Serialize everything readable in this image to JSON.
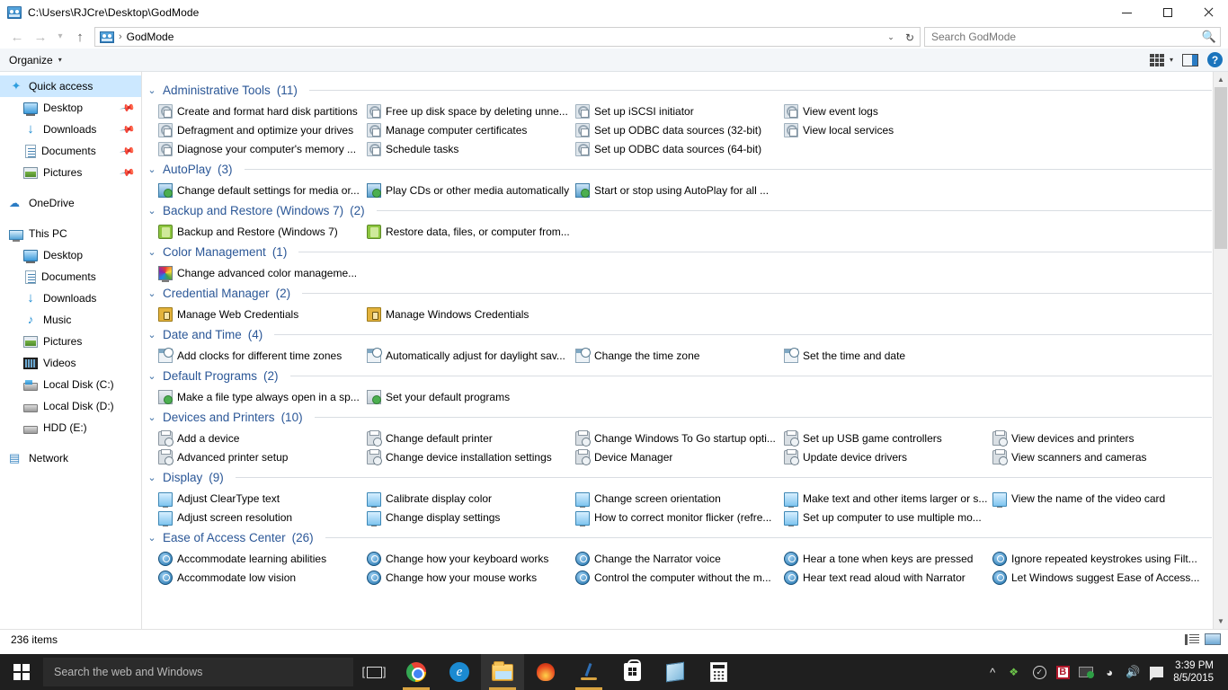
{
  "window": {
    "title": "C:\\Users\\RJCre\\Desktop\\GodMode",
    "minimize_label": "Minimize",
    "maximize_label": "Maximize",
    "close_label": "Close"
  },
  "address": {
    "back_label": "Back",
    "forward_label": "Forward",
    "recent_label": "Recent locations",
    "up_label": "Up",
    "crumb": "GodMode",
    "separator": "›",
    "dropdown": "⌄",
    "refresh": "↻"
  },
  "search": {
    "placeholder": "Search GodMode",
    "value": "",
    "icon": "search-icon"
  },
  "toolbar": {
    "organize_label": "Organize",
    "caret": "▾",
    "view_icon": "grid-view-icon",
    "preview_icon": "preview-pane-icon",
    "help_label": "?"
  },
  "sidebar": {
    "items": [
      {
        "label": "Quick access",
        "icon": "star-icon",
        "indent": 0,
        "selected": true,
        "pinned": false
      },
      {
        "label": "Desktop",
        "icon": "desktop-icon",
        "indent": 1,
        "selected": false,
        "pinned": true
      },
      {
        "label": "Downloads",
        "icon": "download-icon",
        "indent": 1,
        "selected": false,
        "pinned": true
      },
      {
        "label": "Documents",
        "icon": "document-icon",
        "indent": 1,
        "selected": false,
        "pinned": true
      },
      {
        "label": "Pictures",
        "icon": "picture-icon",
        "indent": 1,
        "selected": false,
        "pinned": true
      },
      {
        "label": "OneDrive",
        "icon": "cloud-icon",
        "indent": 0,
        "selected": false,
        "pinned": false,
        "gap_before": true
      },
      {
        "label": "This PC",
        "icon": "pc-icon",
        "indent": 0,
        "selected": false,
        "pinned": false,
        "gap_before": true
      },
      {
        "label": "Desktop",
        "icon": "desktop-icon",
        "indent": 1,
        "selected": false,
        "pinned": false
      },
      {
        "label": "Documents",
        "icon": "document-icon",
        "indent": 1,
        "selected": false,
        "pinned": false
      },
      {
        "label": "Downloads",
        "icon": "download-icon",
        "indent": 1,
        "selected": false,
        "pinned": false
      },
      {
        "label": "Music",
        "icon": "music-icon",
        "indent": 1,
        "selected": false,
        "pinned": false
      },
      {
        "label": "Pictures",
        "icon": "picture-icon",
        "indent": 1,
        "selected": false,
        "pinned": false
      },
      {
        "label": "Videos",
        "icon": "video-icon",
        "indent": 1,
        "selected": false,
        "pinned": false
      },
      {
        "label": "Local Disk (C:)",
        "icon": "system-drive-icon",
        "indent": 1,
        "selected": false,
        "pinned": false
      },
      {
        "label": "Local Disk (D:)",
        "icon": "drive-icon",
        "indent": 1,
        "selected": false,
        "pinned": false
      },
      {
        "label": "HDD (E:)",
        "icon": "drive-icon",
        "indent": 1,
        "selected": false,
        "pinned": false
      },
      {
        "label": "Network",
        "icon": "network-icon",
        "indent": 0,
        "selected": false,
        "pinned": false,
        "gap_before": true
      }
    ]
  },
  "groups": [
    {
      "title": "Administrative Tools",
      "count": "(11)",
      "icon_class": "i-admin",
      "icon_name": "administrative-tools-icon",
      "items": [
        "Create and format hard disk partitions",
        "Defragment and optimize your drives",
        "Diagnose your computer's memory ...",
        "Free up disk space by deleting unne...",
        "Manage computer certificates",
        "Schedule tasks",
        "Set up iSCSI initiator",
        "Set up ODBC data sources (32-bit)",
        "Set up ODBC data sources (64-bit)",
        "View event logs",
        "View local services"
      ]
    },
    {
      "title": "AutoPlay",
      "count": "(3)",
      "icon_class": "i-autoplay",
      "icon_name": "autoplay-icon",
      "items": [
        "Change default settings for media or...",
        "Play CDs or other media automatically",
        "Start or stop using AutoPlay for all ..."
      ]
    },
    {
      "title": "Backup and Restore (Windows 7)",
      "count": "(2)",
      "icon_class": "i-backup",
      "icon_name": "backup-restore-icon",
      "items": [
        "Backup and Restore (Windows 7)",
        "Restore data, files, or computer from..."
      ]
    },
    {
      "title": "Color Management",
      "count": "(1)",
      "icon_class": "i-color",
      "icon_name": "color-management-icon",
      "items": [
        "Change advanced color manageme..."
      ]
    },
    {
      "title": "Credential Manager",
      "count": "(2)",
      "icon_class": "i-cred",
      "icon_name": "credential-manager-icon",
      "items": [
        "Manage Web Credentials",
        "Manage Windows Credentials"
      ]
    },
    {
      "title": "Date and Time",
      "count": "(4)",
      "icon_class": "i-date",
      "icon_name": "date-time-icon",
      "items": [
        "Add clocks for different time zones",
        "Automatically adjust for daylight sav...",
        "Change the time zone",
        "Set the time and date"
      ]
    },
    {
      "title": "Default Programs",
      "count": "(2)",
      "icon_class": "i-defprog",
      "icon_name": "default-programs-icon",
      "items": [
        "Make a file type always open in a sp...",
        "Set your default programs"
      ]
    },
    {
      "title": "Devices and Printers",
      "count": "(10)",
      "icon_class": "i-device",
      "icon_name": "devices-printers-icon",
      "items": [
        "Add a device",
        "Advanced printer setup",
        "Change default printer",
        "Change device installation settings",
        "Change Windows To Go startup opti...",
        "Device Manager",
        "Set up USB game controllers",
        "Update device drivers",
        "View devices and printers",
        "View scanners and cameras"
      ]
    },
    {
      "title": "Display",
      "count": "(9)",
      "icon_class": "i-display",
      "icon_name": "display-icon",
      "items": [
        "Adjust ClearType text",
        "Adjust screen resolution",
        "Calibrate display color",
        "Change display settings",
        "Change screen orientation",
        "How to correct monitor flicker (refre...",
        "Make text and other items larger or s...",
        "Set up computer to use multiple mo...",
        "View the name of the video card"
      ]
    },
    {
      "title": "Ease of Access Center",
      "count": "(26)",
      "icon_class": "i-ease",
      "icon_name": "ease-of-access-icon",
      "items": [
        "Accommodate learning abilities",
        "Accommodate low vision",
        "Change how your keyboard works",
        "Change how your mouse works",
        "Change the Narrator voice",
        "Control the computer without the m...",
        "Hear a tone when keys are pressed",
        "Hear text read aloud with Narrator",
        "Ignore repeated keystrokes using Filt...",
        "Let Windows suggest Ease of Access..."
      ]
    }
  ],
  "statusbar": {
    "items_count": "236 items",
    "details_view_icon": "details-view-icon",
    "large-icons_view_icon": "large-icons-view-icon"
  },
  "taskbar": {
    "start_label": "Start",
    "search_placeholder": "Search the web and Windows",
    "task_view_label": "Task View",
    "apps": [
      {
        "name": "google-chrome-taskbar-icon",
        "running": true,
        "active": false
      },
      {
        "name": "microsoft-edge-taskbar-icon",
        "running": false,
        "active": false
      },
      {
        "name": "file-explorer-taskbar-icon",
        "running": true,
        "active": true
      },
      {
        "name": "firewall-taskbar-icon",
        "running": false,
        "active": false
      },
      {
        "name": "snip-sketch-taskbar-icon",
        "running": true,
        "active": false
      },
      {
        "name": "microsoft-store-taskbar-icon",
        "running": false,
        "active": false
      },
      {
        "name": "onenote-taskbar-icon",
        "running": false,
        "active": false
      },
      {
        "name": "calculator-taskbar-icon",
        "running": false,
        "active": false
      }
    ],
    "tray": [
      "show-hidden-icons-chevron",
      "dragon-tray-icon",
      "action-center-check-icon",
      "bitdefender-tray-icon",
      "network-adapter-tray-icon",
      "wifi-tray-icon",
      "volume-tray-icon",
      "notifications-tray-icon"
    ],
    "time": "3:39 PM",
    "date": "8/5/2015"
  }
}
